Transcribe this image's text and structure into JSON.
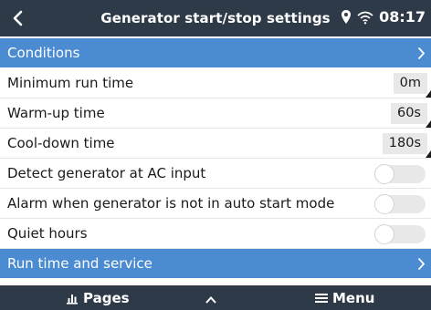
{
  "header": {
    "title": "Generator start/stop settings",
    "time": "08:17"
  },
  "rows": [
    {
      "label": "Conditions",
      "type": "nav",
      "highlighted": true
    },
    {
      "label": "Minimum run time",
      "type": "value",
      "value": "0m"
    },
    {
      "label": "Warm-up time",
      "type": "value",
      "value": "60s"
    },
    {
      "label": "Cool-down time",
      "type": "value",
      "value": "180s"
    },
    {
      "label": "Detect generator at AC input",
      "type": "toggle",
      "checked": false
    },
    {
      "label": "Alarm when generator is not in auto start mode",
      "type": "toggle",
      "checked": false
    },
    {
      "label": "Quiet hours",
      "type": "toggle",
      "checked": false
    },
    {
      "label": "Run time and service",
      "type": "nav",
      "highlighted": true
    }
  ],
  "footer": {
    "pages_label": "Pages",
    "menu_label": "Menu"
  },
  "colors": {
    "header_bg": "#2e3a48",
    "highlight_bg": "#4a8bd1",
    "value_bg": "#e8e8e8"
  }
}
